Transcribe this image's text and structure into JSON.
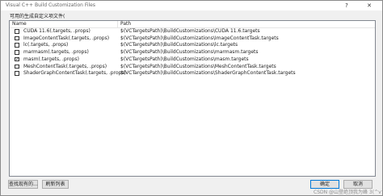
{
  "window": {
    "title": "Visual C++ Build Customization Files",
    "help_label": "?",
    "close_label": "✕"
  },
  "subtitle": "可用的生成自定义项文件(",
  "list": {
    "headers": {
      "name": "Name",
      "path": "Path"
    },
    "rows": [
      {
        "name": "CUDA 11.6(.targets, .props)",
        "path": "$(VCTargetsPath)\\BuildCustomizations\\CUDA 11.6.targets",
        "checked": false,
        "check_glyph": ""
      },
      {
        "name": "ImageContentTask(.targets, .props)",
        "path": "$(VCTargetsPath)\\BuildCustomizations\\ImageContentTask.targets",
        "checked": false,
        "check_glyph": ""
      },
      {
        "name": "lc(.targets, .props)",
        "path": "$(VCTargetsPath)\\BuildCustomizations\\lc.targets",
        "checked": false,
        "check_glyph": ""
      },
      {
        "name": "marmasm(.targets, .props)",
        "path": "$(VCTargetsPath)\\BuildCustomizations\\marmasm.targets",
        "checked": false,
        "check_glyph": ""
      },
      {
        "name": "masm(.targets, .props)",
        "path": "$(VCTargetsPath)\\BuildCustomizations\\masm.targets",
        "checked": true,
        "check_glyph": "✓"
      },
      {
        "name": "MeshContentTask(.targets, .props)",
        "path": "$(VCTargetsPath)\\BuildCustomizations\\MeshContentTask.targets",
        "checked": false,
        "check_glyph": ""
      },
      {
        "name": "ShaderGraphContentTask(.targets, .props)",
        "path": "$(VCTargetsPath)\\BuildCustomizations\\ShaderGraphContentTask.targets",
        "checked": false,
        "check_glyph": ""
      }
    ]
  },
  "buttons": {
    "find": "查找现有的...",
    "refresh": "刷新列表",
    "ok": "确定",
    "cancel": "取消"
  },
  "watermark": "CSDN @山登绝顶我为峰 3(^v^)3"
}
